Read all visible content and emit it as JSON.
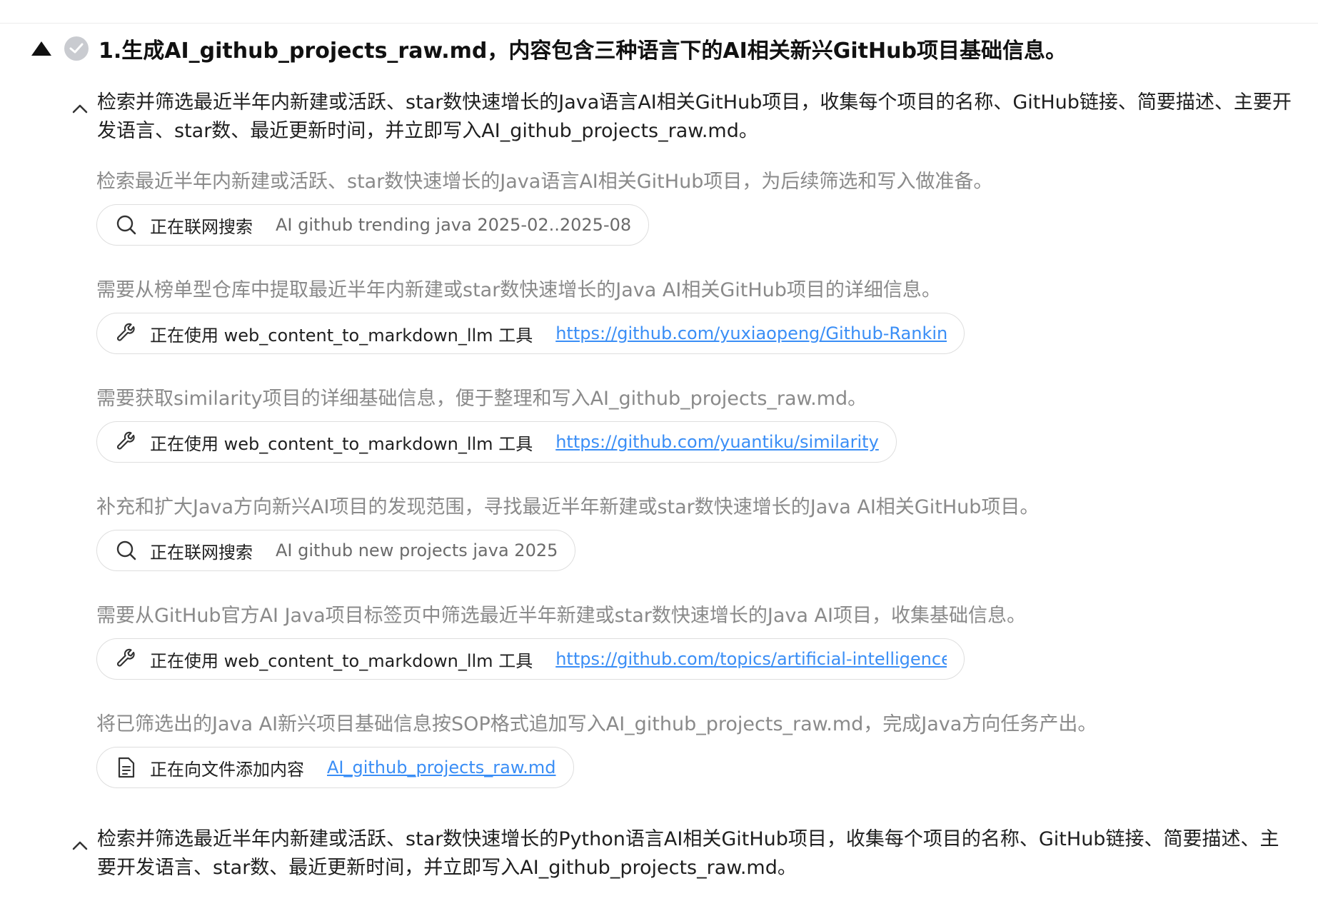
{
  "task": {
    "title": "1.生成AI_github_projects_raw.md，内容包含三种语言下的AI相关新兴GitHub项目基础信息。"
  },
  "subtasks": [
    {
      "title": "检索并筛选最近半年内新建或活跃、star数快速增长的Java语言AI相关GitHub项目，收集每个项目的名称、GitHub链接、简要描述、主要开发语言、star数、最近更新时间，并立即写入AI_github_projects_raw.md。"
    },
    {
      "title": "检索并筛选最近半年内新建或活跃、star数快速增长的Python语言AI相关GitHub项目，收集每个项目的名称、GitHub链接、简要描述、主要开发语言、star数、最近更新时间，并立即写入AI_github_projects_raw.md。"
    }
  ],
  "steps": [
    {
      "desc": "检索最近半年内新建或活跃、star数快速增长的Java语言AI相关GitHub项目，为后续筛选和写入做准备。",
      "icon": "search-icon",
      "action": "正在联网搜索",
      "query": "AI github trending java 2025-02..2025-08"
    },
    {
      "desc": "需要从榜单型仓库中提取最近半年内新建或star数快速增长的Java AI相关GitHub项目的详细信息。",
      "icon": "wrench-icon",
      "action": "正在使用 web_content_to_markdown_llm 工具",
      "link": "https://github.com/yuxiaopeng/Github-Ranking-A"
    },
    {
      "desc": "需要获取similarity项目的详细基础信息，便于整理和写入AI_github_projects_raw.md。",
      "icon": "wrench-icon",
      "action": "正在使用 web_content_to_markdown_llm 工具",
      "link": "https://github.com/yuantiku/similarity"
    },
    {
      "desc": "补充和扩大Java方向新兴AI项目的发现范围，寻找最近半年新建或star数快速增长的Java AI相关GitHub项目。",
      "icon": "search-icon",
      "action": "正在联网搜索",
      "query": "AI github new projects java 2025"
    },
    {
      "desc": "需要从GitHub官方AI Java项目标签页中筛选最近半年新建或star数快速增长的Java AI项目，收集基础信息。",
      "icon": "wrench-icon",
      "action": "正在使用 web_content_to_markdown_llm 工具",
      "link": "https://github.com/topics/artificial-intelligence?l="
    },
    {
      "desc": "将已筛选出的Java AI新兴项目基础信息按SOP格式追加写入AI_github_projects_raw.md，完成Java方向任务产出。",
      "icon": "document-icon",
      "action": "正在向文件添加内容",
      "link": "AI_github_projects_raw.md"
    }
  ]
}
